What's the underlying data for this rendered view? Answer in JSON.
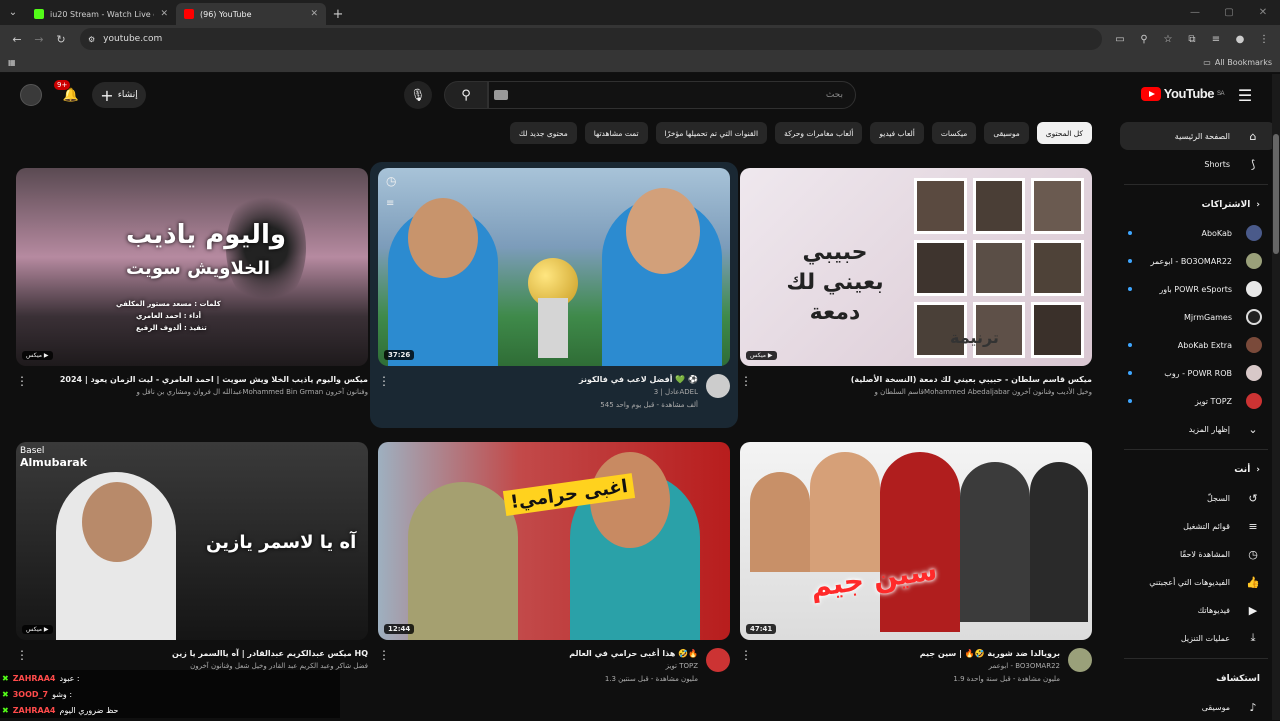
{
  "browser": {
    "tabs": [
      {
        "title": "iu20 Stream - Watch Live on Ki",
        "fav": "#53fc18"
      },
      {
        "title": "(96) YouTube",
        "fav": "#ff0000"
      }
    ],
    "url": "youtube.com",
    "all_bookmarks": "All Bookmarks"
  },
  "yt": {
    "logo": "YouTube",
    "region": "SA",
    "search_placeholder": "بحث",
    "create_label": "إنشاء",
    "notif_badge": "9+"
  },
  "chips": [
    "كل المحتوى",
    "موسيقى",
    "ميكسات",
    "ألعاب فيديو",
    "ألعاب مغامرات وحركة",
    "القنوات التي تم تحميلها مؤخرًا",
    "تمت مشاهدتها",
    "محتوى جديد لك"
  ],
  "sidebar": {
    "main": [
      {
        "label": "الصفحة الرئيسية",
        "icon": "home-icon"
      },
      {
        "label": "Shorts",
        "icon": "shorts-icon"
      }
    ],
    "subs_title": "الاشتراكات",
    "subs": [
      {
        "label": "AboKab",
        "color": "#4a5a8a",
        "dot": true
      },
      {
        "label": "ابوعمر - BO3OMAR22",
        "color": "#9aa07a",
        "dot": true
      },
      {
        "label": "باور POWR eSports",
        "color": "#e8e8e8",
        "dot": true
      },
      {
        "label": "MjrmGames",
        "color": "#222",
        "dot": false
      },
      {
        "label": "AboKab Extra",
        "color": "#7a4a3a",
        "dot": true
      },
      {
        "label": "روب - POWR ROB",
        "color": "#d8c8c8",
        "dot": true
      },
      {
        "label": "تويز TOPZ",
        "color": "#cc3333",
        "dot": true
      }
    ],
    "show_more": "إظهار المزيد",
    "you_title": "أنت",
    "you": [
      {
        "label": "السجلّ",
        "icon": "history-icon"
      },
      {
        "label": "قوائم التشغيل",
        "icon": "playlist-icon"
      },
      {
        "label": "المشاهدة لاحقًا",
        "icon": "clock-icon"
      },
      {
        "label": "الفيديوهات التي أعجبتني",
        "icon": "thumbs-up-icon"
      },
      {
        "label": "فيديوهاتك",
        "icon": "video-icon"
      },
      {
        "label": "عمليات التنزيل",
        "icon": "download-icon"
      }
    ],
    "explore_title": "استكشاف",
    "explore": [
      {
        "label": "موسيقى",
        "icon": "music-icon"
      }
    ]
  },
  "videos": [
    {
      "title": "ميكس قاسم سلطان - حبيبي بعيني لك دمعة (النسخة الأصلية)",
      "sub1": "قاسم السلطان وMohammed Abedaljabar وخيل الأديب وفنانون آخرون",
      "sub2": "",
      "tag": "ميكس",
      "thumb_text": "حبيبي بعيني لك دمعة",
      "thumb_text2": "ترنيمة",
      "av": ""
    },
    {
      "title": "أفضل لاعب في فالكونز 💚 ⚽",
      "sub1": "عادل | 3ADEL",
      "sub2": "545 ألف مشاهدة - قبل يوم واحد",
      "tag": "37:26",
      "thumb_text": "",
      "thumb_text2": "",
      "av": "#ccc"
    },
    {
      "title": "ميكس واليوم ياذيب الخلا ويش سويت | احمد العامري - ليت الزمان يعود | 2024",
      "sub1": "عبدالله ال فروان ومشاري بن نافل وMohammed Bin Grman وفنانون آخرون",
      "sub2": "",
      "tag": "ميكس",
      "thumb_text": "واليوم ياذيب",
      "thumb_text2": "الخلاويش سويت",
      "thumb_text3": "كلمات : مسعد مستور المكلفي",
      "thumb_text4": "أداء : احمد العامري",
      "thumb_text5": "تنفيذ : ألدوف الرفيع",
      "av": ""
    },
    {
      "title": "برويالدا ضد شورية 🤣🔥 | سين جيم",
      "sub1": "ابوعمر - BO3OMAR22",
      "sub2": "1.9 مليون مشاهدة - قبل سنة واحدة",
      "tag": "47:41",
      "thumb_text": "سين جيم",
      "av": "#9aa07a"
    },
    {
      "title": "هذا أغبى حرامي في العالم 🤣🔥",
      "sub1": "تويز TOPZ",
      "sub2": "1.3 مليون مشاهدة - قبل سنتين",
      "tag": "12:44",
      "thumb_text": "اغبى حرامي!",
      "av": "#cc3333"
    },
    {
      "title": "ميكس عبدالكريم عبدالقادر | آه ياالسمر يا زين HQ",
      "sub1": "فضل شاكر وعبد الكريم عبد القادر وخيل شعل وفنانون آخرون",
      "sub2": "",
      "tag": "ميكس",
      "thumb_text": "آه يا لاسمر يازين",
      "thumb_text2": "Basel",
      "thumb_text3": "Almubarak",
      "av": ""
    }
  ],
  "chat": [
    {
      "name": "ZAHRAA4",
      "msg": "عبود :"
    },
    {
      "name": "3OOD_7",
      "msg": "وشو :"
    },
    {
      "name": "ZAHRAA4",
      "msg": "حظ ضروري اليوم"
    }
  ]
}
